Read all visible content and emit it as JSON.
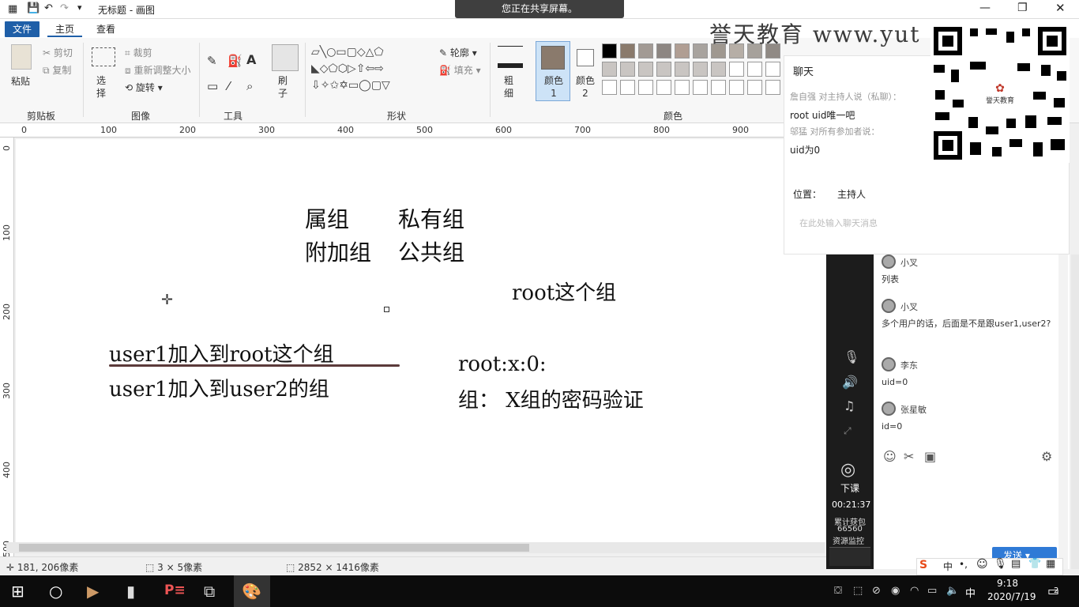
{
  "title": "无标题 - 画图",
  "share_banner": "您正在共享屏幕。",
  "menu": {
    "file": "文件",
    "home": "主页",
    "view": "查看"
  },
  "ribbon": {
    "paste": "粘贴",
    "cut": "剪切",
    "copy": "复制",
    "clipboard": "剪贴板",
    "select": "选择",
    "crop": "裁剪",
    "resize": "重新调整大小",
    "rotate": "旋转",
    "image": "图像",
    "tools": "工具",
    "brush": "刷子",
    "shapes": "形状",
    "outline": "轮廓",
    "fill": "填充",
    "size": "粗细",
    "color1": "颜色 1",
    "color2": "颜色 2",
    "colors": "颜色"
  },
  "watermark": "誉天教育  www.yut",
  "ruler_h": [
    "0",
    "100",
    "200",
    "300",
    "400",
    "500",
    "600",
    "700",
    "800",
    "900"
  ],
  "ruler_v": [
    "0",
    "100",
    "200",
    "300",
    "400",
    "500"
  ],
  "canvas": {
    "l1a": "属组",
    "l1b": "私有组",
    "l2a": "附加组",
    "l2b": "公共组",
    "l3": "root这个组",
    "l4": "user1加入到root这个组",
    "l5": "user1加入到user2的组",
    "l6": "root:x:0:",
    "l7": "组：  X组的密码验证"
  },
  "status": {
    "pos": "181, 206像素",
    "sel": "3 × 5像素",
    "size": "2852 × 1416像素"
  },
  "chat": {
    "title": "聊天",
    "m1_from": "詹自强 对主持人说（私聊）：",
    "m1_text": "root uid唯一吧",
    "m2_from": "邬猛 对所有参加者说：",
    "m2_text": "uid为0",
    "position_label": "位置：",
    "position_value": "主持人",
    "placeholder": "在此处输入聊天消息",
    "list": [
      {
        "name": "小叉",
        "text": "列表"
      },
      {
        "name": "小叉",
        "text": "多个用户的话，后面是不是跟user1,user2?"
      },
      {
        "name": "李东",
        "text": "uid=0"
      },
      {
        "name": "张星敏",
        "text": "id=0"
      }
    ],
    "send": "发送"
  },
  "live": {
    "end": "下课",
    "timer": "00:21:37",
    "flow": "累计获包",
    "flow_val": "66560",
    "monitor": "资源监控"
  },
  "taskbar": {
    "time": "9:18",
    "date": "2020/7/19",
    "ime": "中",
    "notif": "2"
  },
  "colors": {
    "accent": "#1f5fa8",
    "color1": "#8a7a6c"
  }
}
